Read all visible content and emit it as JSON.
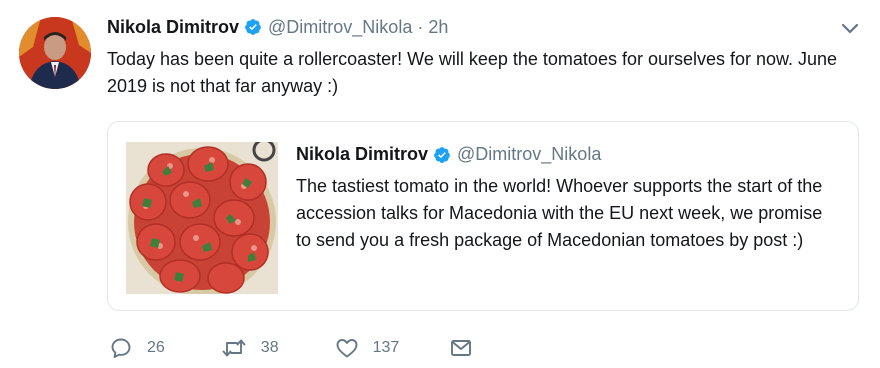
{
  "tweet": {
    "author_name": "Nikola Dimitrov",
    "handle": "@Dimitrov_Nikola",
    "separator": "·",
    "time": "2h",
    "text": "Today has been quite a rollercoaster! We will keep the tomatoes for ourselves for now. June 2019 is not that far anyway :)",
    "icons": {
      "verified": "verified-badge-icon",
      "menu": "chevron-down-icon"
    }
  },
  "quote": {
    "author_name": "Nikola Dimitrov",
    "handle": "@Dimitrov_Nikola",
    "text": "The tastiest tomato in the world! Whoever supports the start of the accession talks for Macedonia with the EU next week, we promise to send you a fresh package of Macedonian tomatoes by post :)",
    "image": "sliced-tomatoes-photo"
  },
  "actions": {
    "reply_count": "26",
    "retweet_count": "38",
    "like_count": "137",
    "icons": [
      "reply-icon",
      "retweet-icon",
      "like-icon",
      "message-icon"
    ]
  },
  "colors": {
    "verified": "#1da1f2",
    "secondary_text": "#657786",
    "border": "#e1e8ed"
  }
}
